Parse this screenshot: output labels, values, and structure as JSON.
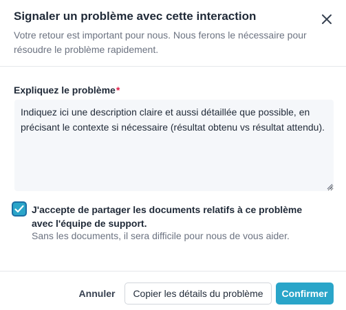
{
  "dialog": {
    "title": "Signaler un problème avec cette interaction",
    "subtitle": "Votre retour est important pour nous. Nous ferons le nécessaire pour résoudre le problème rapidement.",
    "close_icon": "close-icon"
  },
  "form": {
    "field_label": "Expliquez le problème",
    "required_marker": "*",
    "textarea_placeholder": "Indiquez ici une description claire et aussi détaillée que possible, en précisant le contexte si nécessaire (résultat obtenu vs résultat attendu).",
    "textarea_value": "",
    "consent": {
      "checked": true,
      "label": "J'accepte de partager les documents relatifs à ce problème avec l'équipe de support.",
      "hint": "Sans les documents, il sera difficile pour nous de vous aider."
    }
  },
  "footer": {
    "cancel_label": "Annuler",
    "copy_label": "Copier les détails du problème",
    "confirm_label": "Confirmer"
  },
  "colors": {
    "accent": "#2aa5c9",
    "required": "#e11d48",
    "textarea_bg": "#f5f7fa"
  }
}
